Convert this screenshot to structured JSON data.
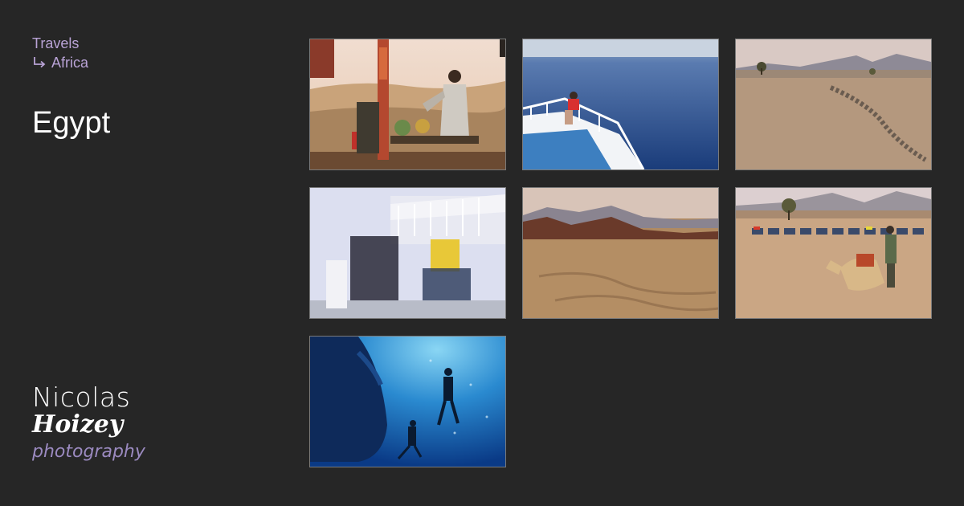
{
  "breadcrumb": {
    "parent": "Travels",
    "child": "Africa"
  },
  "page_title": "Egypt",
  "logo": {
    "line1": "Nicolas",
    "line2": "Hoizey",
    "line3": "photography"
  },
  "colors": {
    "background": "#262626",
    "accent": "#b9a3d6",
    "title": "#ffffff",
    "logo_tagline": "#9b8ac0"
  },
  "photos": [
    {
      "subject": "man at a bedouin tea stand in the desert"
    },
    {
      "subject": "person at the bow of a white boat on the sea"
    },
    {
      "subject": "desert plain with a line of stones and mountains"
    },
    {
      "subject": "blurred divers on the deck of a boat"
    },
    {
      "subject": "desert sand with rocky mountains"
    },
    {
      "subject": "man with a resting camel and a row of quad bikes"
    },
    {
      "subject": "divers underwater beneath a boat hull"
    }
  ]
}
